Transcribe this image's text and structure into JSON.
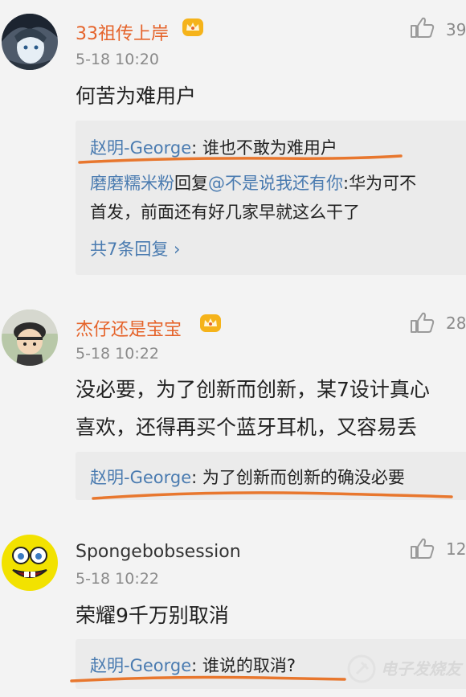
{
  "comments": [
    {
      "username": "33祖传上岸",
      "time": "5-18 10:20",
      "likes": "39",
      "text_lines": [
        "何苦为难用户"
      ],
      "reply1_name": "赵明-George",
      "reply1_text": ": 谁也不敢为难用户",
      "reply2_name": "磨磨糯米粉",
      "reply2_mid": "回复",
      "reply2_mention": "@不是说我还有你",
      "reply2_text": ":华为可不",
      "reply2_line2": "首发，前面还有好几家早就这么干了",
      "more_replies": "共7条回复 ›"
    },
    {
      "username": "杰仔还是宝宝",
      "time": "5-18 10:22",
      "likes": "28",
      "text_lines": [
        "没必要，为了创新而创新，某7设计真心",
        "喜欢，还得再买个蓝牙耳机，又容易丢"
      ],
      "reply1_name": "赵明-George",
      "reply1_text": ": 为了创新而创新的确没必要"
    },
    {
      "username": "Spongebobsession",
      "time": "5-18 10:22",
      "likes": "12",
      "text_lines": [
        "荣耀9千万别取消"
      ],
      "reply1_name": "赵明-George",
      "reply1_text": ": 谁说的取消?"
    }
  ],
  "colors": {
    "accent_name": "#e5632a",
    "link": "#4a7bb0",
    "underline": "#e8772e"
  },
  "watermark": "电子发烧友"
}
